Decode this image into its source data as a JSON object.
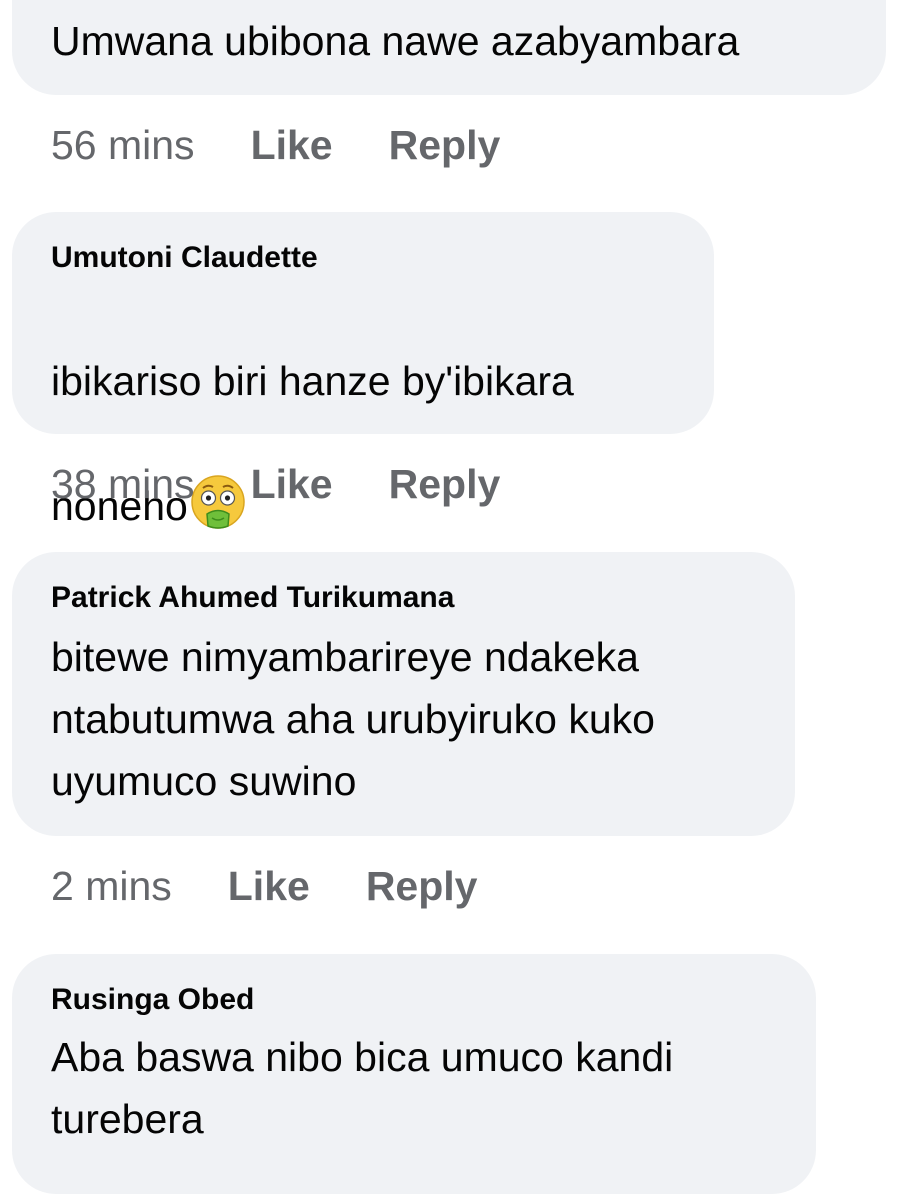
{
  "comments": [
    {
      "author": "",
      "text": "Umwana ubibona nawe azabyambara",
      "time": "56 mins",
      "like": "Like",
      "reply": "Reply"
    },
    {
      "author": "Umutoni Claudette",
      "text_line1": "ibikariso biri hanze  by'ibikara",
      "text_line2": "noneho",
      "emoji": "nauseated-face-emoji",
      "time": "38 mins",
      "like": "Like",
      "reply": "Reply"
    },
    {
      "author": "Patrick Ahumed Turikumana",
      "text": "bitewe nimyambarireye ndakeka\nntabutumwa aha urubyiruko kuko\nuyumuco suwino",
      "time": "2 mins",
      "like": "Like",
      "reply": "Reply"
    },
    {
      "author": "Rusinga Obed",
      "text": "Aba baswa nibo bica umuco kandi\nturebera"
    }
  ],
  "colors": {
    "bubble_bg": "#f0f2f5",
    "text": "#050505",
    "meta": "#65676b"
  }
}
